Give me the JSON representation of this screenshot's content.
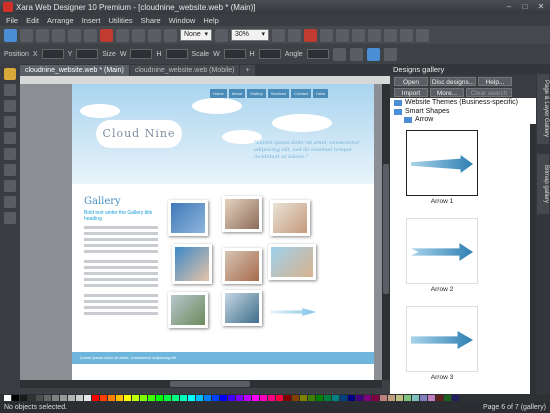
{
  "window": {
    "title": "Xara Web Designer 10 Premium - [cloudnine_website.web * (Main)]"
  },
  "menu": [
    "File",
    "Edit",
    "Arrange",
    "Insert",
    "Utilities",
    "Share",
    "Window",
    "Help"
  ],
  "toolbar": {
    "quality_select": "None",
    "zoom_select": "30%"
  },
  "infobar": {
    "position_label": "Position",
    "x_label": "X",
    "y_label": "Y",
    "size_label": "Size",
    "w_label": "W",
    "h_label": "H",
    "scale_label": "Scale",
    "angle_label": "Angle"
  },
  "tabs": [
    "cloudnine_website.web * (Main)",
    "cloudnine_website.web (Mobile)"
  ],
  "new_tab": "+",
  "page": {
    "nav": [
      "Home",
      "About",
      "Gallery",
      "Services",
      "Contact",
      "Links"
    ],
    "logo": "Cloud Nine",
    "quote": "\"Lorem ipsum dolor sit amet, consectetur adipiscing elit, sed do eiusmod tempor incididunt ut labore.\"",
    "gallery_title": "Gallery",
    "gallery_subtitle": "Bold text under the Gallery title heading",
    "footer": "Lorem ipsum dolor sit amet, consectetur adipiscing elit"
  },
  "gallery": {
    "title": "Designs gallery",
    "buttons": {
      "open": "Open",
      "disc_designs": "Disc designs...",
      "help": "Help...",
      "import": "Import",
      "more": "More...",
      "clear_search": "Clear search"
    },
    "tree": {
      "folder1": "Website Themes (Business-specific)",
      "folder2": "Smart Shapes",
      "subfolder": "Arrow"
    },
    "items": [
      "Arrow 1",
      "Arrow 2",
      "Arrow 3"
    ]
  },
  "side_tabs": [
    "Page & Layer Gallery",
    "Bitmap gallery"
  ],
  "status": {
    "left": "No objects selected.",
    "right": "Page 6 of 7 (gallery)"
  },
  "palette": [
    "#ffffff",
    "#000000",
    "#1a1a1a",
    "#333333",
    "#4d4d4d",
    "#666666",
    "#808080",
    "#999999",
    "#b3b3b3",
    "#cccccc",
    "#e6e6e6",
    "#ff0000",
    "#ff4000",
    "#ff8000",
    "#ffbf00",
    "#ffff00",
    "#bfff00",
    "#80ff00",
    "#40ff00",
    "#00ff00",
    "#00ff40",
    "#00ff80",
    "#00ffbf",
    "#00ffff",
    "#00bfff",
    "#0080ff",
    "#0040ff",
    "#0000ff",
    "#4000ff",
    "#8000ff",
    "#bf00ff",
    "#ff00ff",
    "#ff00bf",
    "#ff0080",
    "#ff0040",
    "#800000",
    "#804000",
    "#808000",
    "#408000",
    "#008000",
    "#008040",
    "#008080",
    "#004080",
    "#000080",
    "#400080",
    "#800080",
    "#800040",
    "#c08080",
    "#c0a080",
    "#c0c080",
    "#80c080",
    "#80c0c0",
    "#8080c0",
    "#c080c0",
    "#602020",
    "#206020",
    "#202060"
  ]
}
